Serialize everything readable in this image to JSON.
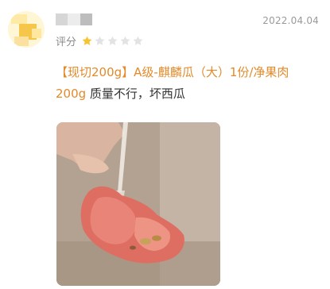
{
  "review": {
    "date": "2022.04.04",
    "rating_label": "评分",
    "rating": 1,
    "rating_max": 5,
    "product_name": "【现切200g】A级-麒麟瓜（大）1份/净果肉200g",
    "comment": " 质量不行，坏西瓜"
  },
  "colors": {
    "accent": "#e38a2a",
    "star_active": "#f7c431",
    "star_inactive": "#e3e3e3",
    "date_text": "#9a9a9a"
  },
  "icons": {
    "star": "star-icon"
  }
}
